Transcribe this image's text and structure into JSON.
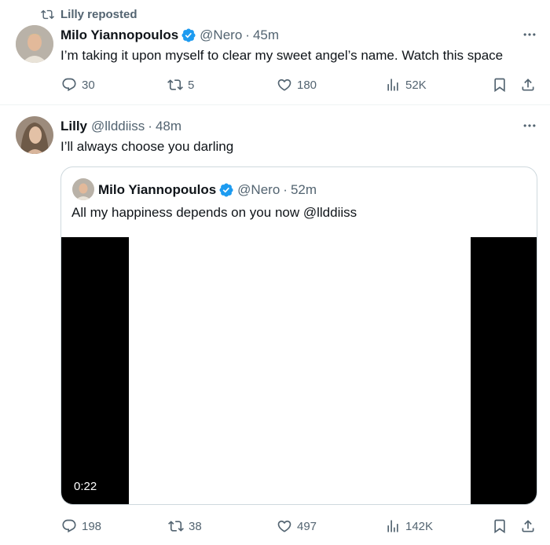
{
  "tweet1": {
    "repost_label": "Lilly reposted",
    "author_name": "Milo Yiannopoulos",
    "handle": "@Nero",
    "separator": "·",
    "time": "45m",
    "text": "I’m taking it upon myself to clear my sweet angel’s name. Watch this space",
    "replies": "30",
    "reposts": "5",
    "likes": "180",
    "views": "52K"
  },
  "tweet2": {
    "author_name": "Lilly",
    "handle": "@llddiiss",
    "separator": "·",
    "time": "48m",
    "text": "I’ll always choose you darling",
    "replies": "198",
    "reposts": "38",
    "likes": "497",
    "views": "142K",
    "quote": {
      "author_name": "Milo Yiannopoulos",
      "handle": "@Nero",
      "separator": "·",
      "time": "52m",
      "text": "All my happiness depends on you now @llddiiss",
      "video_duration": "0:22"
    }
  },
  "colors": {
    "text_primary": "#0f1419",
    "text_secondary": "#536471",
    "verified_blue": "#1d9bf0",
    "border": "#cfd9de"
  },
  "icons": {
    "repost": "repost-icon",
    "reply": "reply-icon",
    "like": "heart-icon",
    "views": "views-icon",
    "bookmark": "bookmark-icon",
    "share": "share-icon",
    "more": "more-icon",
    "verified": "verified-icon"
  }
}
